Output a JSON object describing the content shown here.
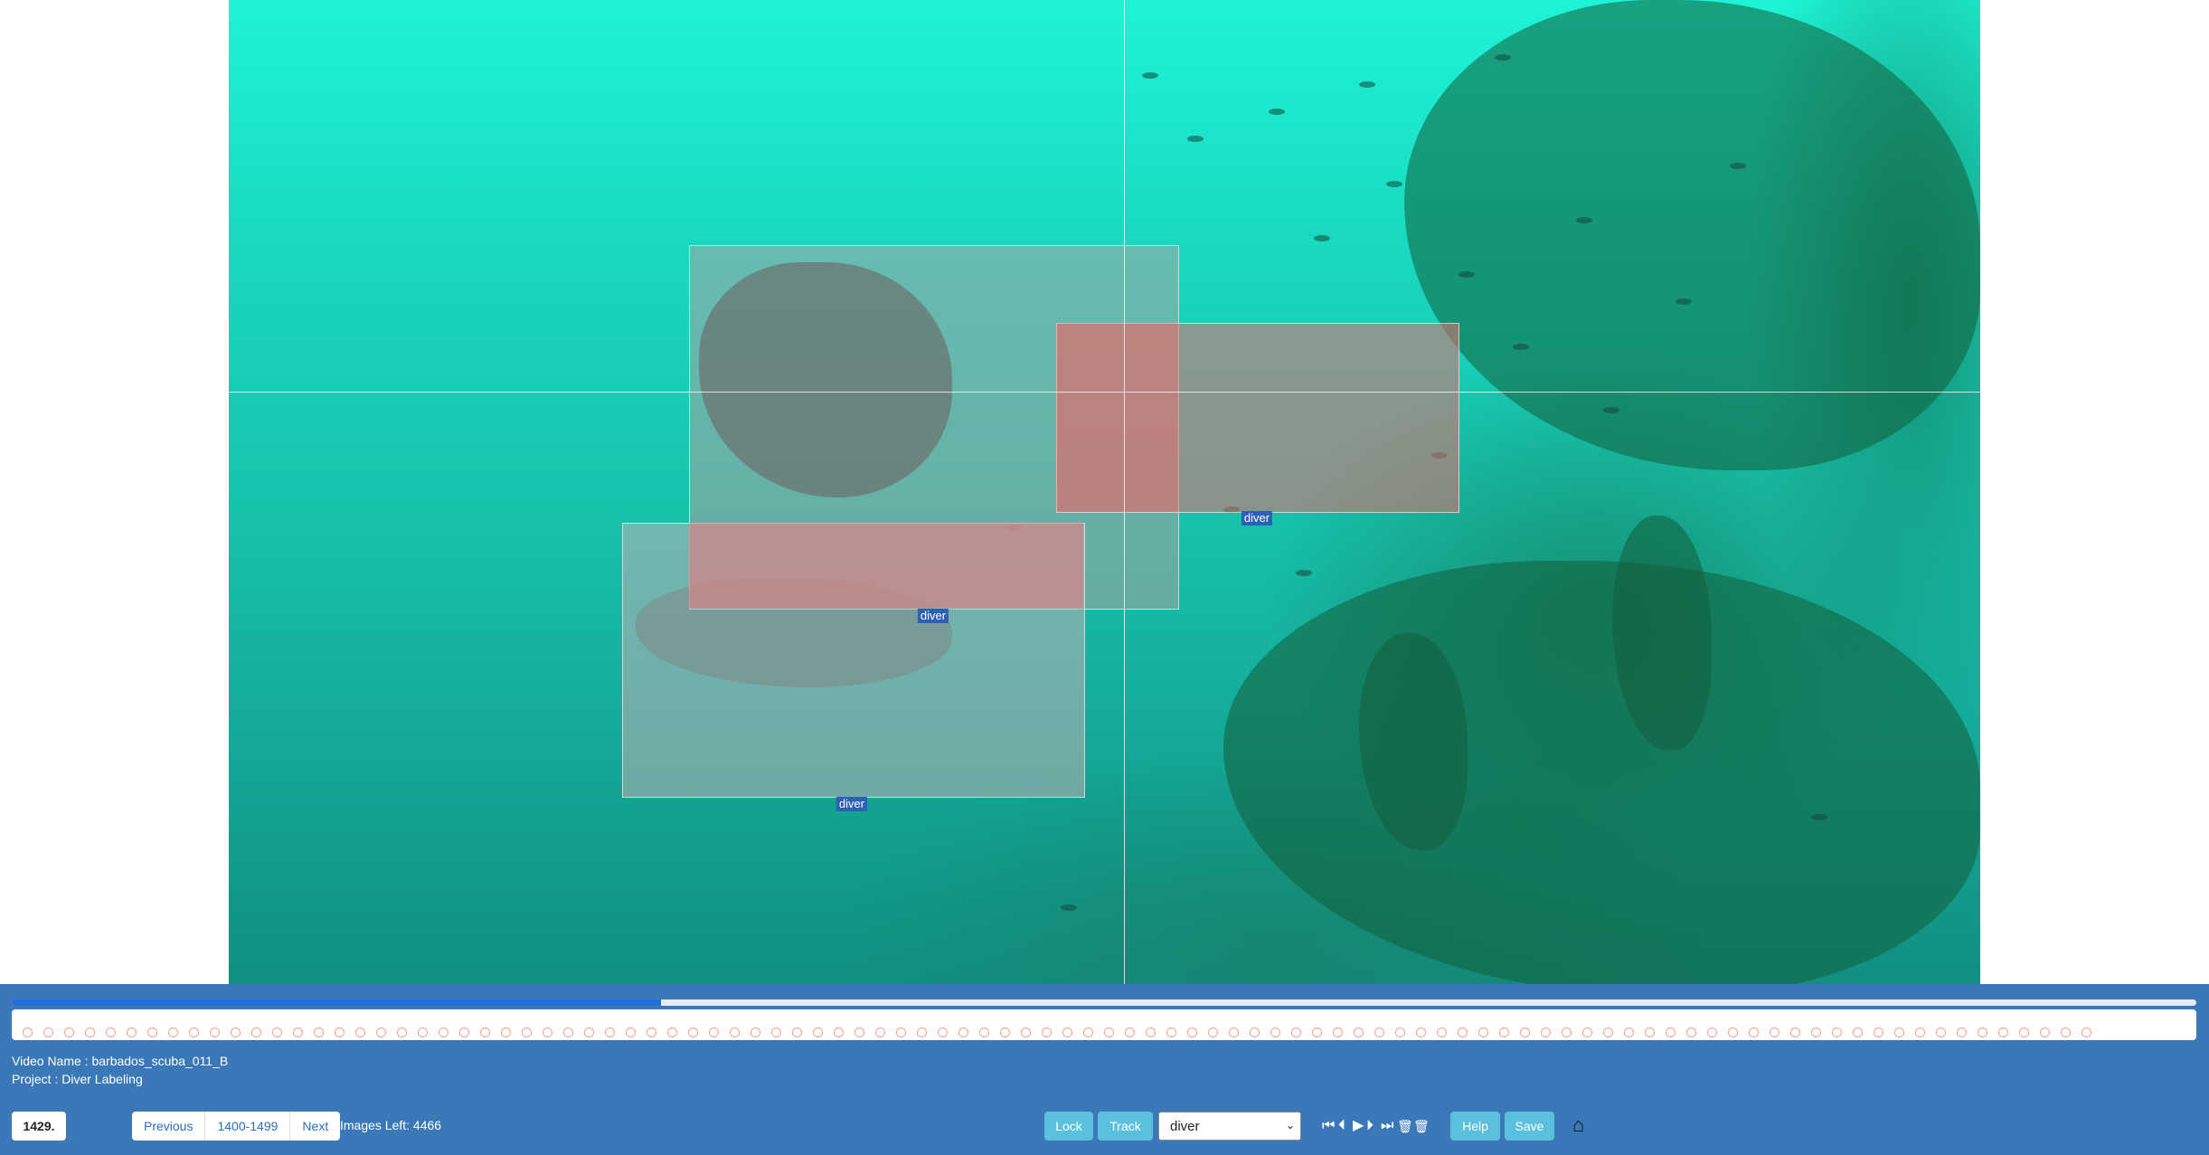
{
  "labels": [
    {
      "text": "diver"
    },
    {
      "text": "diver"
    },
    {
      "text": "diver"
    }
  ],
  "progress": {
    "fraction": 0.297
  },
  "frame_strip": {
    "dot_count": 100
  },
  "info": {
    "video_name": "Video Name : barbados_scuba_011_B",
    "project": "Project : Diver Labeling"
  },
  "frame_number": "1429.",
  "pager": {
    "previous": "Previous",
    "range": "1400-1499",
    "next": "Next"
  },
  "images_left": "Images Left: 4466",
  "buttons": {
    "lock": "Lock",
    "track": "Track",
    "help": "Help",
    "save": "Save"
  },
  "class_select": {
    "selected": "diver"
  },
  "icons": {
    "first": "⏮",
    "prev": "⏴",
    "play": "▶",
    "next": "⏵",
    "last": "⏭",
    "delete": "🗑",
    "delete_all": "🗑",
    "home": "⌂"
  },
  "colors": {
    "panel": "#3a78b8",
    "label_bg": "#2d5fb4",
    "button": "#5bc0de"
  }
}
